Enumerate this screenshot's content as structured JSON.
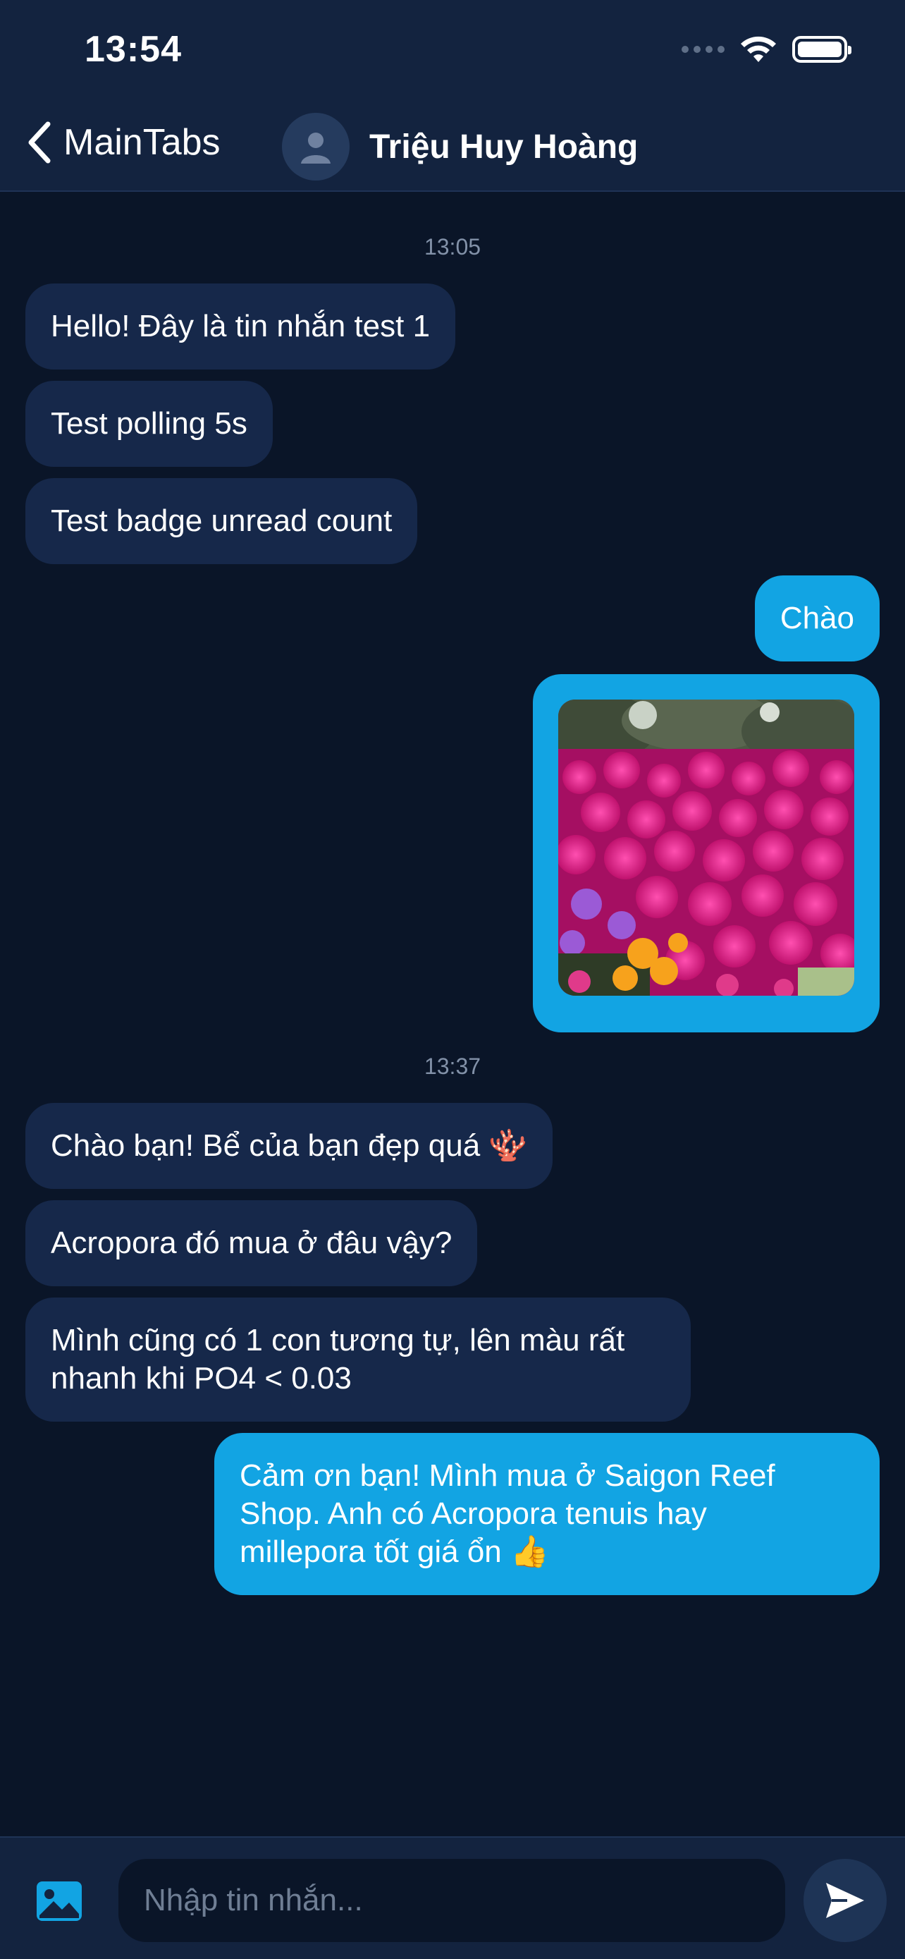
{
  "status_bar": {
    "time": "13:54"
  },
  "header": {
    "back_label": "MainTabs",
    "contact_name": "Triệu Huy Hoàng"
  },
  "messages": {
    "group1_time": "13:05",
    "m1": "Hello! Đây là tin nhắn test 1",
    "m2": "Test polling 5s",
    "m3": "Test badge unread count",
    "m4": "Chào",
    "group2_time": "13:37",
    "m5": "Chào bạn! Bể của bạn đẹp quá 🪸",
    "m6": "Acropora đó mua ở đâu vậy?",
    "m7": "Mình cũng có 1 con tương tự, lên màu rất\nnhanh khi PO4 < 0.03",
    "m8": "Cảm ơn bạn! Mình mua ở Saigon Reef\nShop. Anh có Acropora tenuis hay\nmillepora tốt giá ổn 👍"
  },
  "composer": {
    "placeholder": "Nhập tin nhắn...",
    "value": ""
  },
  "colors": {
    "background": "#0a1528",
    "header": "#13233f",
    "incoming_bubble": "#16284a",
    "outgoing_bubble": "#12a4e3"
  }
}
